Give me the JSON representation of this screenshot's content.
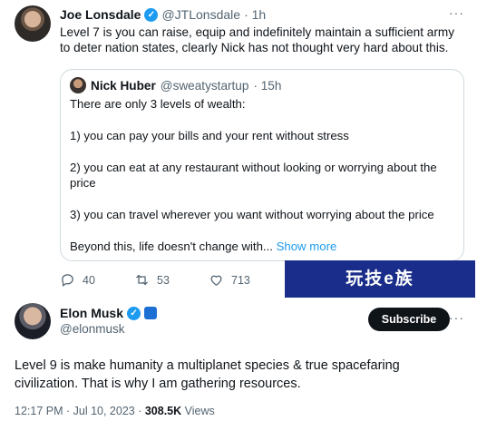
{
  "tweet1": {
    "author_name": "Joe Lonsdale",
    "handle": "@JTLonsdale",
    "time": "· 1h",
    "more": "···",
    "body": "Level 7 is you can raise, equip and indefinitely maintain a sufficient army to deter nation states, clearly Nick has not thought very hard about this.",
    "quote": {
      "author_name": "Nick Huber",
      "handle": "@sweatystartup",
      "time": "· 15h",
      "lines": [
        "There are only 3 levels of wealth:",
        "1) you can pay your bills and your rent without stress",
        "2) you can eat at any restaurant without looking or worrying about the price",
        "3) you can travel wherever you want without worrying about the price",
        "Beyond this, life doesn't change with..."
      ],
      "show_more": "Show more"
    },
    "actions": {
      "replies": "40",
      "retweets": "53",
      "likes": "713"
    }
  },
  "watermark": "玩技e族",
  "tweet2": {
    "author_name": "Elon Musk",
    "handle": "@elonmusk",
    "more": "···",
    "subscribe_label": "Subscribe",
    "body": "Level 9 is make humanity a multiplanet species & true spacefaring civilization. That is why I am gathering resources.",
    "time": "12:17 PM · Jul 10, 2023 · ",
    "views_count": "308.5K",
    "views_label": " Views"
  },
  "colors": {
    "accent": "#1d9bf0",
    "muted": "#536471",
    "watermark_bg": "#1a2d8a"
  }
}
